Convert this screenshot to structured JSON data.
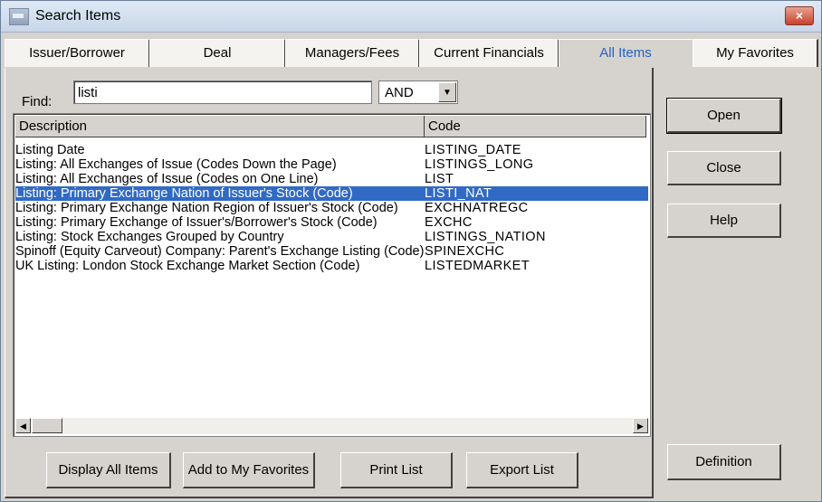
{
  "window": {
    "title": "Search Items",
    "close": "×"
  },
  "tabs": [
    {
      "label": "Issuer/Borrower"
    },
    {
      "label": "Deal"
    },
    {
      "label": "Managers/Fees"
    },
    {
      "label": "Current Financials"
    },
    {
      "label": "All Items",
      "active": true
    },
    {
      "label": "My Favorites"
    }
  ],
  "find": {
    "label": "Find:",
    "value": "listi",
    "operator": "AND"
  },
  "columns": {
    "description": "Description",
    "code": "Code"
  },
  "rows": [
    {
      "description": "Listing Date",
      "code": "LISTING_DATE"
    },
    {
      "description": "Listing: All Exchanges of Issue (Codes Down the Page)",
      "code": "LISTINGS_LONG"
    },
    {
      "description": "Listing: All Exchanges of Issue (Codes on One Line)",
      "code": "LIST"
    },
    {
      "description": "Listing: Primary Exchange Nation of Issuer's Stock (Code)",
      "code": "LISTI_NAT",
      "selected": true
    },
    {
      "description": "Listing: Primary Exchange Nation Region of Issuer's Stock (Code)",
      "code": "EXCHNATREGC"
    },
    {
      "description": "Listing: Primary Exchange of Issuer's/Borrower's Stock (Code)",
      "code": "EXCHC"
    },
    {
      "description": "Listing: Stock Exchanges Grouped by Country",
      "code": "LISTINGS_NATION"
    },
    {
      "description": "Spinoff (Equity Carveout) Company: Parent's Exchange Listing (Code)",
      "code": "SPINEXCHC"
    },
    {
      "description": "UK Listing: London Stock Exchange Market Section (Code)",
      "code": "LISTEDMARKET"
    }
  ],
  "buttons": {
    "open": "Open",
    "close": "Close",
    "help": "Help",
    "display_all": "Display All Items",
    "add_favorites": "Add to My Favorites",
    "print_list": "Print List",
    "export_list": "Export List",
    "definition": "Definition"
  },
  "icons": {
    "scroll_left": "◀",
    "scroll_right": "▶",
    "dropdown": "▼"
  }
}
